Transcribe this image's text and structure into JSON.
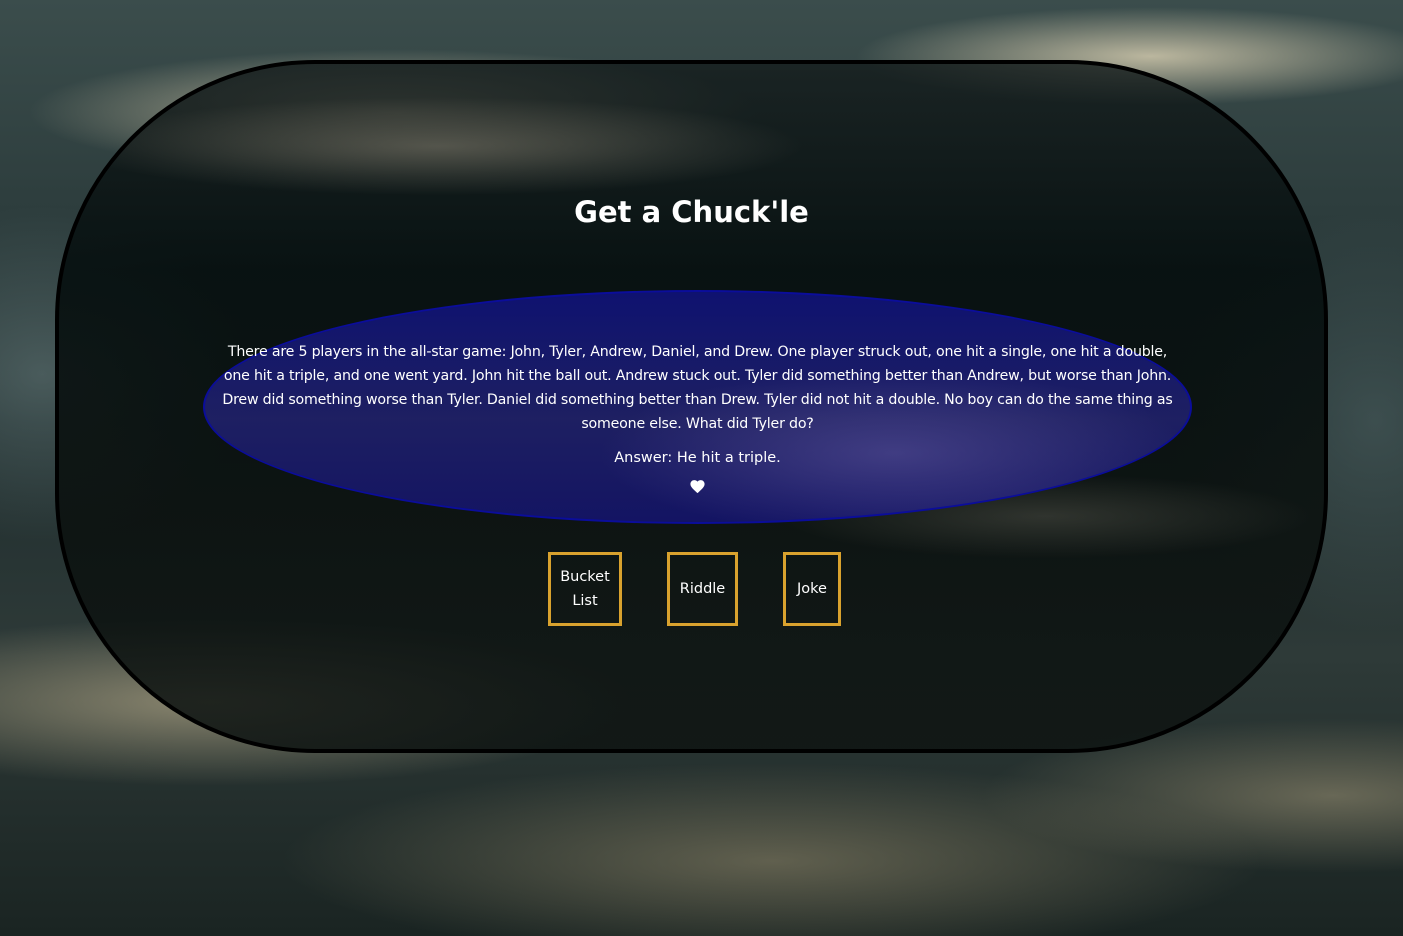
{
  "header": {
    "title": "Get a Chuck'le"
  },
  "riddle": {
    "question": "There are 5 players in the all-star game: John, Tyler, Andrew, Daniel, and Drew. One player struck out, one hit a single, one hit a double, one hit a triple, and one went yard. John hit the ball out. Andrew stuck out. Tyler did something better than Andrew, but worse than John. Drew did something worse than Tyler. Daniel did something better than Drew. Tyler did not hit a double. No boy can do the same thing as someone else. What did Tyler do?",
    "answer": "Answer: He hit a triple.",
    "favorite_icon": "heart-icon"
  },
  "nav": {
    "bucket_list_label": "Bucket List",
    "riddle_label": "Riddle",
    "joke_label": "Joke"
  },
  "colors": {
    "button_border": "#d9a22e",
    "riddle_border": "#0b0d9a",
    "card_border": "#000000"
  }
}
